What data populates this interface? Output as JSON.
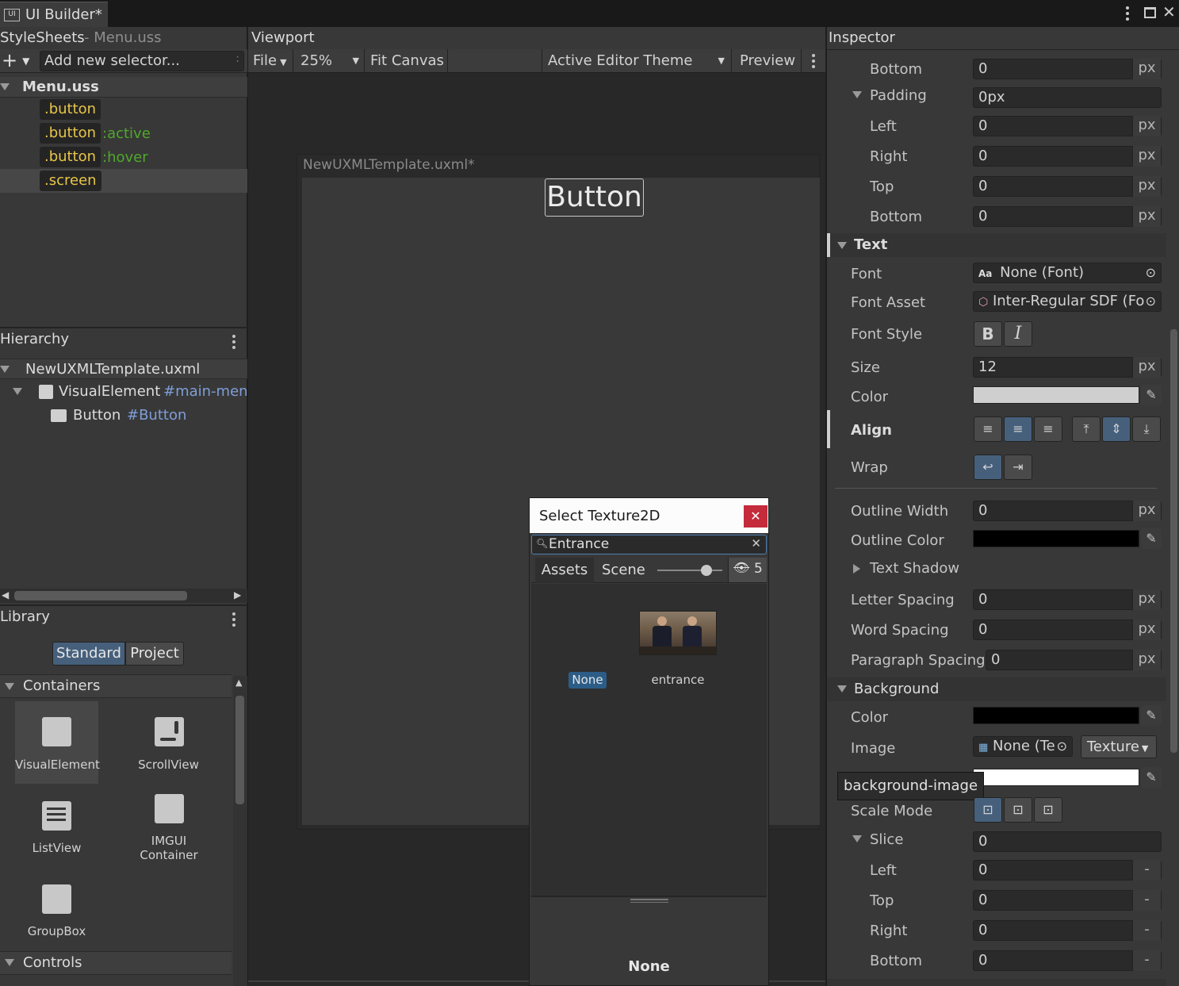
{
  "window": {
    "tab_title": "UI Builder*",
    "tab_icon": "UI"
  },
  "stylesheets": {
    "title": "StyleSheets",
    "subtitle": "- Menu.uss",
    "add_selector_placeholder": "Add new selector...",
    "file": "Menu.uss",
    "selectors": [
      {
        "name": ".button",
        "pseudo": ""
      },
      {
        "name": ".button",
        "pseudo": ":active"
      },
      {
        "name": ".button",
        "pseudo": ":hover"
      },
      {
        "name": ".screen",
        "pseudo": ""
      }
    ]
  },
  "hierarchy": {
    "title": "Hierarchy",
    "root": "NewUXMLTemplate.uxml",
    "items": [
      {
        "type": "VisualElement",
        "name": "#main-menu"
      },
      {
        "type": "Button",
        "name": "#Button"
      }
    ]
  },
  "library": {
    "title": "Library",
    "tabs": [
      "Standard",
      "Project"
    ],
    "containers_label": "Containers",
    "controls_label": "Controls",
    "items": [
      "VisualElement",
      "ScrollView",
      "ListView",
      "IMGUI Container",
      "GroupBox"
    ]
  },
  "viewport": {
    "title": "Viewport",
    "file_menu": "File",
    "zoom": "25%",
    "fit_canvas": "Fit Canvas",
    "theme": "Active Editor Theme",
    "preview": "Preview",
    "canvas_title": "NewUXMLTemplate.uxml*",
    "button_text": "Button"
  },
  "texture_dialog": {
    "title": "Select Texture2D",
    "search_value": "Entrance",
    "tabs": [
      "Assets",
      "Scene"
    ],
    "hidden_count": "5",
    "slider_value": 0.75,
    "items": [
      {
        "label": "None",
        "selected": true
      },
      {
        "label": "entrance",
        "selected": false
      }
    ],
    "footer_selection": "None"
  },
  "inspector": {
    "title": "Inspector",
    "margin_bottom": {
      "label": "Bottom",
      "value": "0",
      "unit": "px"
    },
    "padding": {
      "label": "Padding",
      "value": "0px",
      "left": {
        "label": "Left",
        "value": "0",
        "unit": "px"
      },
      "right": {
        "label": "Right",
        "value": "0",
        "unit": "px"
      },
      "top": {
        "label": "Top",
        "value": "0",
        "unit": "px"
      },
      "bottom": {
        "label": "Bottom",
        "value": "0",
        "unit": "px"
      }
    },
    "text": {
      "section": "Text",
      "font_label": "Font",
      "font_value": "None (Font)",
      "font_icon": "Aa",
      "font_asset_label": "Font Asset",
      "font_asset_value": "Inter-Regular SDF (Fo",
      "font_style_label": "Font Style",
      "bold": "B",
      "italic": "I",
      "size_label": "Size",
      "size_value": "12",
      "size_unit": "px",
      "color_label": "Color",
      "color_value": "#cfcfcf",
      "align_label": "Align",
      "wrap_label": "Wrap",
      "outline_width_label": "Outline Width",
      "outline_width_value": "0",
      "outline_width_unit": "px",
      "outline_color_label": "Outline Color",
      "outline_color_value": "#000000",
      "text_shadow_label": "Text Shadow",
      "letter_spacing_label": "Letter Spacing",
      "letter_spacing_value": "0",
      "letter_spacing_unit": "px",
      "word_spacing_label": "Word Spacing",
      "word_spacing_value": "0",
      "word_spacing_unit": "px",
      "paragraph_spacing_label": "Paragraph Spacing",
      "paragraph_spacing_value": "0",
      "paragraph_spacing_unit": "px"
    },
    "background": {
      "section": "Background",
      "color_label": "Color",
      "color_value": "#000000",
      "image_label": "Image",
      "image_value": "None (Te",
      "image_type": "Texture",
      "tooltip": "background-image",
      "tint_value": "#ffffff",
      "scale_mode_label": "Scale Mode",
      "slice_label": "Slice",
      "slice_value": "0",
      "slice_left": {
        "label": "Left",
        "value": "0"
      },
      "slice_top": {
        "label": "Top",
        "value": "0"
      },
      "slice_right": {
        "label": "Right",
        "value": "0"
      },
      "slice_bottom": {
        "label": "Bottom",
        "value": "0"
      },
      "slice_unit": "-"
    }
  }
}
